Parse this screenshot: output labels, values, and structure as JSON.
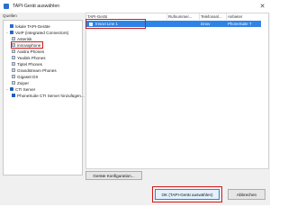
{
  "window": {
    "title": "TAPI-Gerät auswählen",
    "close_glyph": "✕"
  },
  "sources_label": "Quellen",
  "tree": [
    {
      "label": "lokale TAPI-Geräte",
      "icon": "folder-icon"
    },
    {
      "label": "VoIP (integrated Connectors)",
      "icon": "folder-icon"
    },
    {
      "label": "Asterisk",
      "icon": "phone-icon"
    },
    {
      "label": "innovaphone",
      "icon": "phone-icon"
    },
    {
      "label": "Aastra Phones",
      "icon": "phone-icon"
    },
    {
      "label": "Yealink Phones",
      "icon": "phone-icon"
    },
    {
      "label": "Tiptel Phones",
      "icon": "phone-icon"
    },
    {
      "label": "Grandstream Phones",
      "icon": "phone-icon"
    },
    {
      "label": "Gigaset DX",
      "icon": "phone-icon"
    },
    {
      "label": "Zoiper",
      "icon": "phone-icon"
    },
    {
      "label": "CTI Server",
      "icon": "server-icon"
    },
    {
      "label": "PhoneSuite CTI Server hinzufügen...",
      "icon": "server-icon"
    }
  ],
  "grid": {
    "columns": [
      "TAPI-Gerät",
      "Rufnummer...",
      "Telefonanl...",
      "Anbieter"
    ],
    "rows": [
      {
        "device": "Innovi Line 1",
        "number": "",
        "pbx": "innov",
        "provider": "PhoneSuite T"
      }
    ]
  },
  "buttons": {
    "configure": "Geräte Konfiguration...",
    "ok": "OK (TAPI-Gerät auswählen)",
    "cancel": "Abbrechen"
  },
  "colors": {
    "selection": "#2f82e6",
    "highlight": "#d0191b"
  }
}
